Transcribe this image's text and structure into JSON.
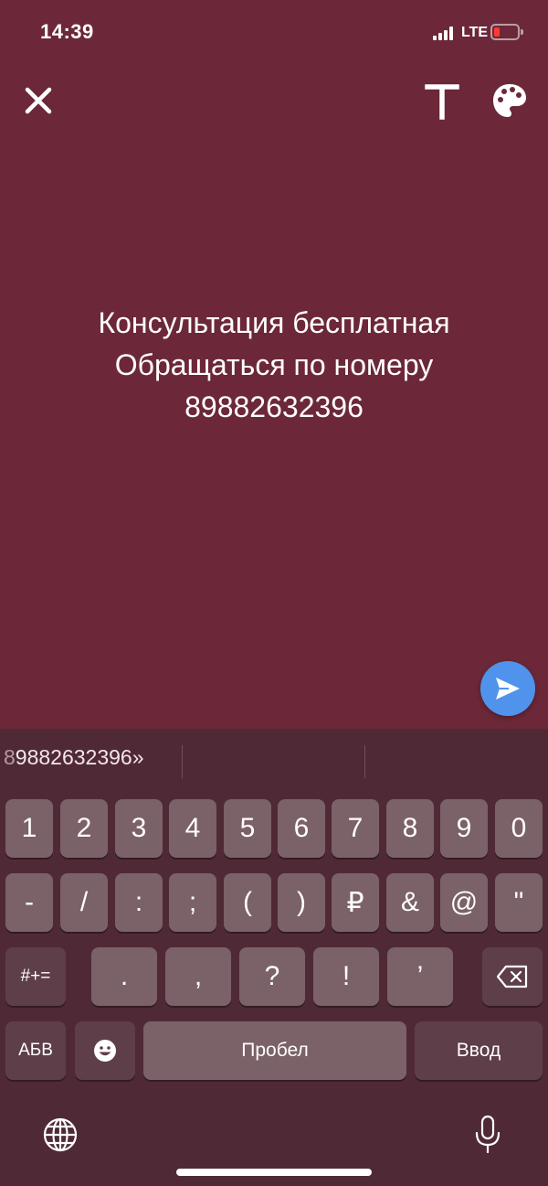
{
  "status_bar": {
    "time": "14:39",
    "network": "LTE",
    "battery_color": "#ff3b30"
  },
  "toolbar": {
    "close_icon": "close-icon",
    "text_tool_label": "T",
    "palette_icon": "palette-icon"
  },
  "story": {
    "background_color": "#6c2838",
    "lines": [
      "Консультация бесплатная",
      "Обращаться по номеру",
      "89882632396"
    ]
  },
  "send_button": {
    "icon": "send-icon",
    "color": "#4f93ec"
  },
  "keyboard": {
    "suggestion_prefix": "8",
    "suggestion_rest": "9882632396»",
    "row1": [
      "1",
      "2",
      "3",
      "4",
      "5",
      "6",
      "7",
      "8",
      "9",
      "0"
    ],
    "row2": [
      "-",
      "/",
      ":",
      ";",
      "(",
      ")",
      "₽",
      "&",
      "@",
      "\""
    ],
    "row3": {
      "symbols_key": "#+=",
      "keys": [
        ".",
        ",",
        "?",
        "!",
        "’"
      ],
      "backspace_icon": "backspace-icon"
    },
    "row4": {
      "alphabet_key": "АБВ",
      "emoji_icon": "emoji-icon",
      "space": "Пробел",
      "return": "Ввод"
    },
    "globe_icon": "globe-icon",
    "mic_icon": "microphone-icon"
  }
}
